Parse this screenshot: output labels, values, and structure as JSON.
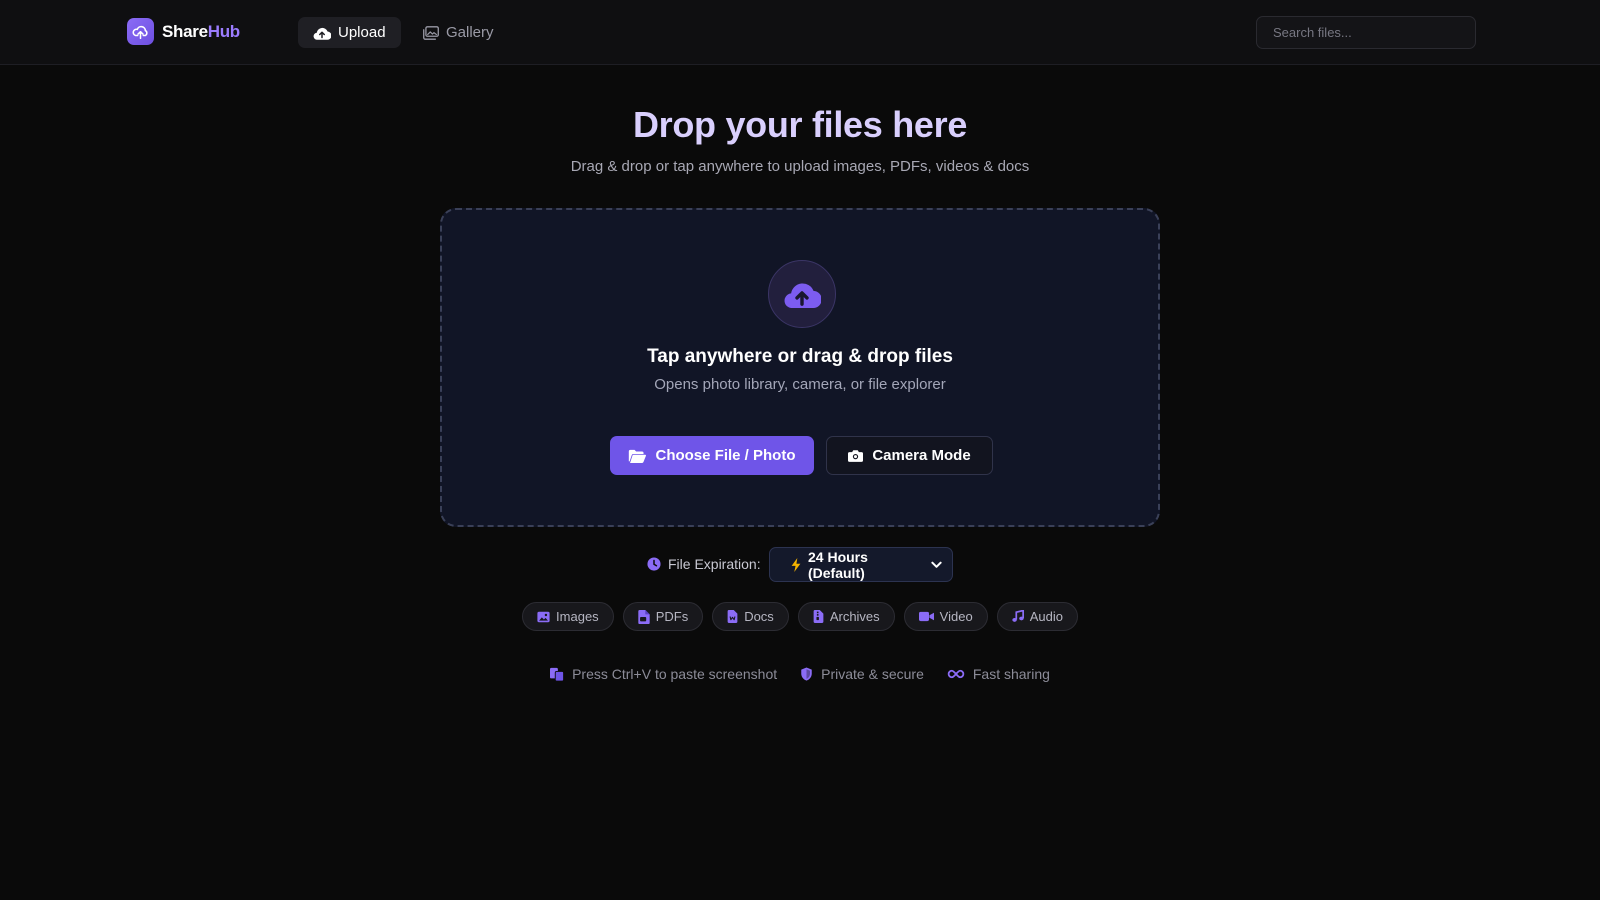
{
  "header": {
    "brand_part1": "Share",
    "brand_part2": "Hub",
    "nav": {
      "upload_label": "Upload",
      "gallery_label": "Gallery"
    },
    "search": {
      "placeholder": "Search files...",
      "value": ""
    }
  },
  "hero": {
    "title": "Drop your files here",
    "subtitle": "Drag & drop or tap anywhere to upload images, PDFs, videos & docs"
  },
  "dropzone": {
    "title": "Tap anywhere or drag & drop files",
    "subtitle": "Opens photo library, camera, or file explorer",
    "choose_label": "Choose File / Photo",
    "camera_label": "Camera Mode"
  },
  "expiration": {
    "label": "File Expiration:",
    "selected": "24 Hours (Default)"
  },
  "chips": [
    {
      "label": "Images",
      "icon": "image-icon"
    },
    {
      "label": "PDFs",
      "icon": "pdf-file-icon"
    },
    {
      "label": "Docs",
      "icon": "doc-file-icon"
    },
    {
      "label": "Archives",
      "icon": "archive-file-icon"
    },
    {
      "label": "Video",
      "icon": "video-icon"
    },
    {
      "label": "Audio",
      "icon": "music-icon"
    }
  ],
  "hints": {
    "paste": "Press Ctrl+V to paste screenshot",
    "secure": "Private & secure",
    "fast": "Fast sharing"
  },
  "colors": {
    "accent": "#6f55e8",
    "accent_light": "#9b7cff",
    "title": "#d9cffd",
    "background": "#0a0a0a"
  }
}
